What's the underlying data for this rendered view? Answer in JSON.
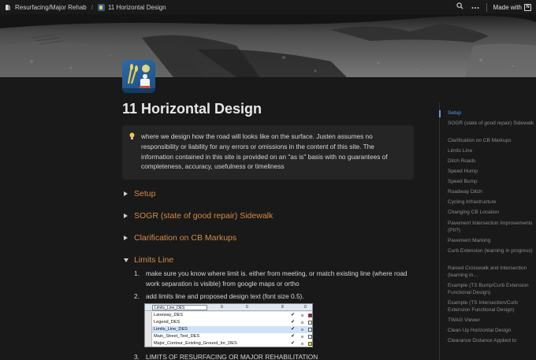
{
  "breadcrumb": {
    "parent": "Resurfacing/Major Rehab",
    "separator": "/",
    "current": "11 Horizontal Design"
  },
  "topbar": {
    "search_icon": "search-icon",
    "more_icon": "more-icon",
    "made_with_label": "Made with",
    "notion_logo_letter": "N"
  },
  "page": {
    "title": "11 Horizontal Design",
    "callout_icon": "lightbulb-icon",
    "callout_text": "where we design how the road will looks like on the surface. Justen assumes no responsibility or liability for any errors or omissions in the content of this site. The information contained in this site is provided on an \"as is\" basis with no guarantees of completeness, accuracy, usefulness or timeliness"
  },
  "toggles": [
    {
      "label": "Setup",
      "open": false
    },
    {
      "label": "SOGR (state of good repair) Sidewalk",
      "open": false
    },
    {
      "label": "Clarification on CB Markups",
      "open": false
    },
    {
      "label": "Limits Line",
      "open": true
    }
  ],
  "limits_line_list": [
    {
      "num": "1.",
      "text": "make sure you know where limit is. either from meeting, or match existing line (where road work separation is visible) from google maps or ortho"
    },
    {
      "num": "2.",
      "text": "add limits line and proposed design text (font size 0.5)."
    },
    {
      "num": "3.",
      "text": "LIMITS OF RESURFACING OR MAJOR REHABILITATION"
    }
  ],
  "embedded_screenshot": {
    "combo_value": "Limits_Line_DES",
    "toolbar_values": [
      "0",
      "0",
      "8",
      "0"
    ],
    "layers": [
      {
        "name": "Laneway_DES",
        "swatch": "#d40000"
      },
      {
        "name": "Legend_DES",
        "swatch": "#ffffff"
      },
      {
        "name": "Limits_Line_DES",
        "swatch": "#ffffff"
      },
      {
        "name": "Main_Street_Text_DES",
        "swatch": "#ffffff"
      },
      {
        "name": "Major_Contour_Existing_Ground_Inr_DES",
        "swatch": "#f5d400"
      }
    ],
    "check_mark": "✔"
  },
  "toc": [
    {
      "label": "Setup",
      "active": true
    },
    {
      "label": "SOGR (state of good repair) Sidewalk",
      "active": false
    },
    {
      "label": "Clarification on CB Markups",
      "active": false
    },
    {
      "label": "Limits Line",
      "active": false
    },
    {
      "label": "Ditch Roads",
      "active": false
    },
    {
      "label": "Speed Hump",
      "active": false
    },
    {
      "label": "Speed Bump",
      "active": false
    },
    {
      "label": "Roadway Ditch",
      "active": false
    },
    {
      "label": "Cycling Infrastructure",
      "active": false
    },
    {
      "label": "Changing CB Location",
      "active": false
    },
    {
      "label": "Pavement Intersection Improvements (PII?)",
      "active": false
    },
    {
      "label": "Pavement Marking",
      "active": false
    },
    {
      "label": "Curb Extension (learning in progress)",
      "active": false
    },
    {
      "label": "Raised Crosswalk and Intersection (learning in…",
      "active": false
    },
    {
      "label": "Example (TS Bump/Curb Extension Functional Design)",
      "active": false
    },
    {
      "label": "Example (TS Intersection/Curb Extension Functional Design)",
      "active": false
    },
    {
      "label": "TWAG Viewer",
      "active": false
    },
    {
      "label": "Clean Up Horizontal Design",
      "active": false
    },
    {
      "label": "Clearance Distance Applied to",
      "active": false
    }
  ]
}
